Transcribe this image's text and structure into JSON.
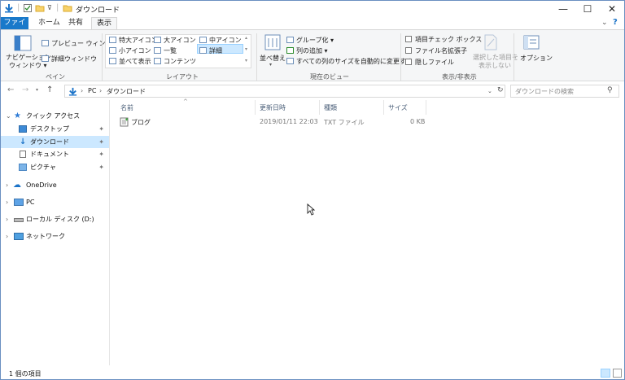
{
  "window": {
    "title": "ダウンロード",
    "controls": [
      "—",
      "☐",
      "✕"
    ]
  },
  "tabs": [
    {
      "label": "ファイル"
    },
    {
      "label": "ホーム"
    },
    {
      "label": "共有"
    },
    {
      "label": "表示"
    }
  ],
  "ribbon": {
    "pane": {
      "nav_pane_line1": "ナビゲーション",
      "nav_pane_line2": "ウィンドウ ▾",
      "preview": "プレビュー ウィンドウ",
      "details": "詳細ウィンドウ",
      "label": "ペイン"
    },
    "layout": {
      "items": [
        "特大アイコン",
        "大アイコン",
        "中アイコン",
        "小アイコン",
        "一覧",
        "詳細",
        "並べて表示",
        "コンテンツ"
      ],
      "label": "レイアウト"
    },
    "current_view": {
      "sort": "並べ替え",
      "group": "グループ化 ▾",
      "add_column": "列の追加 ▾",
      "fit_columns": "すべての列のサイズを自動的に変更する",
      "label": "現在のビュー"
    },
    "show_hide": {
      "item_checkbox": "項目チェック ボックス",
      "file_ext": "ファイル名拡張子",
      "hidden": "隠しファイル",
      "hide_selected_1": "選択した項目を",
      "hide_selected_2": "表示しない",
      "label": "表示/非表示"
    },
    "options": "オプション"
  },
  "address": {
    "path": [
      "PC",
      "ダウンロード"
    ],
    "search_placeholder": "ダウンロードの検索"
  },
  "navpane": {
    "quick_access": "クイック アクセス",
    "desktop": "デスクトップ",
    "downloads": "ダウンロード",
    "documents": "ドキュメント",
    "pictures": "ピクチャ",
    "onedrive": "OneDrive",
    "pc": "PC",
    "local_disk": "ローカル ディスク (D:)",
    "network": "ネットワーク"
  },
  "columns": [
    "名前",
    "更新日時",
    "種類",
    "サイズ"
  ],
  "files": [
    {
      "name": "ブログ",
      "date": "2019/01/11 22:03",
      "type": "TXT ファイル",
      "size": "0 KB"
    }
  ],
  "status": {
    "count": "1 個の項目"
  }
}
